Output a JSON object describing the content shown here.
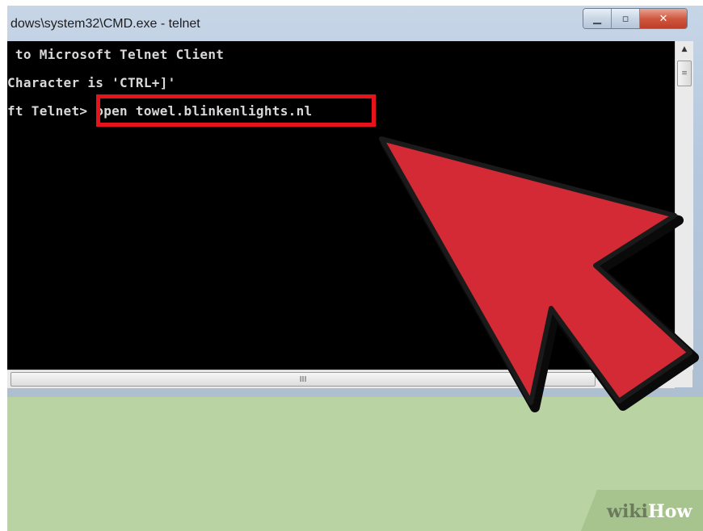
{
  "window": {
    "title": "dows\\system32\\CMD.exe - telnet",
    "minimize_glyph": "▁",
    "maximize_glyph": "▫",
    "close_glyph": "✕"
  },
  "console": {
    "lines": [
      " to Microsoft Telnet Client",
      "Character is 'CTRL+]'",
      "ft Telnet> open towel.blinkenlights.nl"
    ],
    "highlighted_command": "open towel.blinkenlights.nl"
  },
  "scrollbars": {
    "horizontal_grip": "III",
    "vertical_grip": "≡",
    "up_arrow": "▲"
  },
  "annotation": {
    "arrow_color": "#d42a36",
    "box_color": "#e8121a"
  },
  "watermark": {
    "part1": "wiki",
    "part2": "How"
  }
}
